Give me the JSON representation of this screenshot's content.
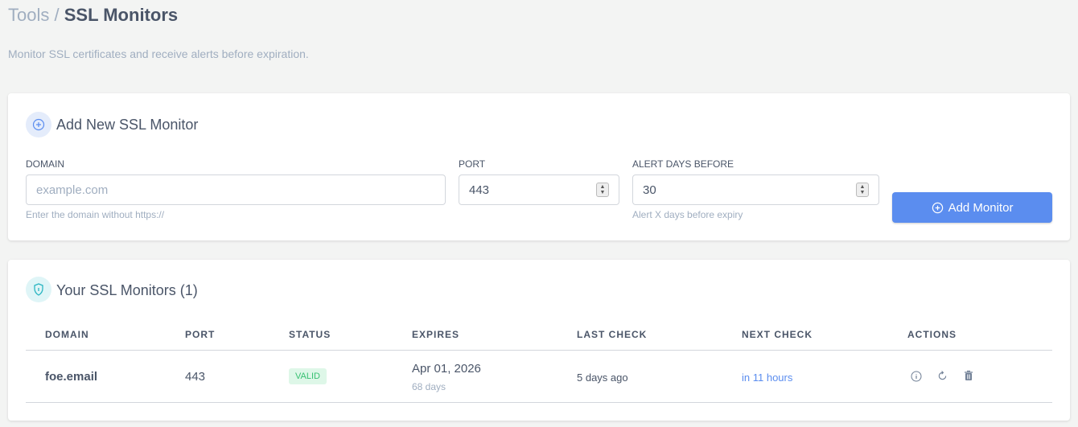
{
  "breadcrumb": {
    "root": "Tools",
    "separator": "/",
    "current": "SSL Monitors"
  },
  "subtitle": "Monitor SSL certificates and receive alerts before expiration.",
  "add_form": {
    "title": "Add New SSL Monitor",
    "icon": "plus-circle-icon",
    "domain": {
      "label": "DOMAIN",
      "placeholder": "example.com",
      "value": "",
      "help": "Enter the domain without https://"
    },
    "port": {
      "label": "PORT",
      "value": "443"
    },
    "alert": {
      "label": "ALERT DAYS BEFORE",
      "value": "30",
      "help": "Alert X days before expiry"
    },
    "submit_label": "Add Monitor"
  },
  "monitors": {
    "title": "Your SSL Monitors (1)",
    "icon": "shield-icon",
    "columns": [
      "DOMAIN",
      "PORT",
      "STATUS",
      "EXPIRES",
      "LAST CHECK",
      "NEXT CHECK",
      "ACTIONS"
    ],
    "rows": [
      {
        "domain": "foe.email",
        "port": "443",
        "status": "VALID",
        "expires": "Apr 01, 2026",
        "expires_in": "68 days",
        "last_check": "5 days ago",
        "next_check": "in 11 hours"
      }
    ]
  },
  "colors": {
    "accent": "#5b8def",
    "valid": "#38c172",
    "link": "#5b8def"
  }
}
